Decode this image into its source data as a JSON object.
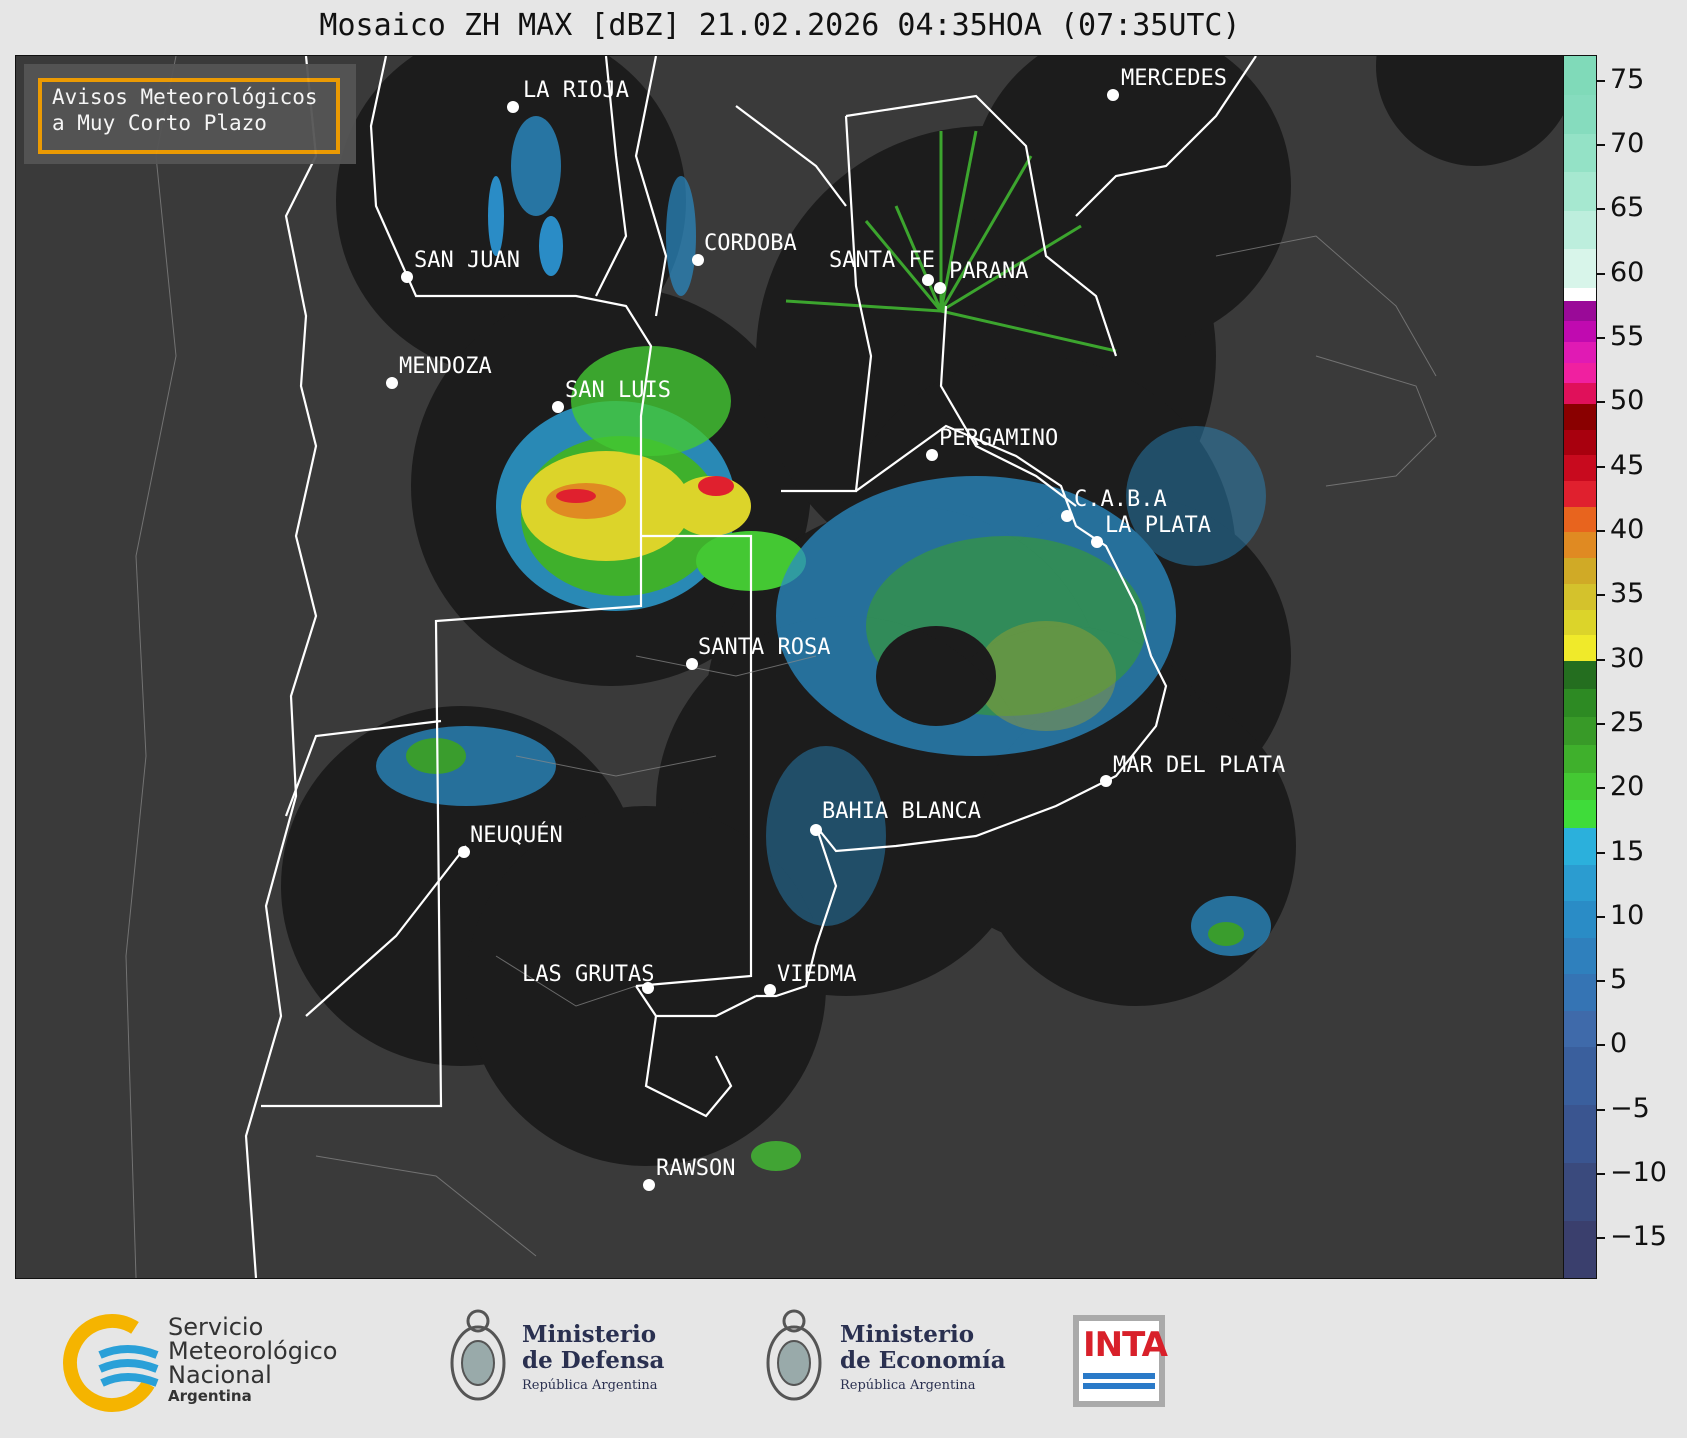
{
  "title": "Mosaico ZH MAX [dBZ] 21.02.2026 04:35HOA (07:35UTC)",
  "notice": {
    "line1": "Avisos Meteorológicos",
    "line2": "a Muy Corto Plazo",
    "border_color": "#f5a000"
  },
  "cities": [
    "LA RIOJA",
    "SAN JUAN",
    "CORDOBA",
    "SANTA FE",
    "PARANA",
    "MERCEDES",
    "MENDOZA",
    "SAN LUIS",
    "PERGAMINO",
    "C.A.B.A",
    "LA PLATA",
    "SANTA ROSA",
    "MAR DEL PLATA",
    "BAHIA BLANCA",
    "NEUQUÉN",
    "LAS GRUTAS",
    "VIEDMA",
    "RAWSON"
  ],
  "colorbar": {
    "unit": "dBZ",
    "ticks": [
      "75",
      "70",
      "65",
      "60",
      "55",
      "50",
      "45",
      "40",
      "35",
      "30",
      "25",
      "20",
      "15",
      "10",
      "5",
      "0",
      "−5",
      "−10",
      "−15"
    ],
    "tick_values": [
      75,
      70,
      65,
      60,
      55,
      50,
      45,
      40,
      35,
      30,
      25,
      20,
      15,
      10,
      5,
      0,
      -5,
      -10,
      -15
    ],
    "range": [
      -18,
      77
    ],
    "bands": [
      {
        "from": -18,
        "to": 0,
        "colors": [
          "#3a3f6d",
          "#3a4a7d",
          "#3a5590",
          "#3a5f9d"
        ]
      },
      {
        "from": 0,
        "to": 17,
        "colors": [
          "#3f6aaa",
          "#3574b4",
          "#2f80bd",
          "#2a8cc6",
          "#2b9cd0",
          "#2bb0dc"
        ]
      },
      {
        "from": 17,
        "to": 30,
        "colors": [
          "#3fdc3a",
          "#44c833",
          "#3fb02c",
          "#389a28",
          "#2d8a23",
          "#246e1f"
        ]
      },
      {
        "from": 30,
        "to": 40,
        "colors": [
          "#f0ea2a",
          "#dcd42a",
          "#d4c22c",
          "#d0aa26",
          "#e08a22"
        ]
      },
      {
        "from": 40,
        "to": 50,
        "colors": [
          "#e8641e",
          "#e0202e",
          "#c80a1e",
          "#a8000e",
          "#8a0000"
        ]
      },
      {
        "from": 50,
        "to": 58,
        "colors": [
          "#e0105a",
          "#f020a0",
          "#e01ab4",
          "#c00ab0",
          "#9a0a98"
        ]
      },
      {
        "from": 58,
        "to": 59,
        "colors": [
          "#ffffff"
        ]
      },
      {
        "from": 59,
        "to": 77,
        "colors": [
          "#d8f5ea",
          "#bdeedd",
          "#a6e8d0",
          "#94e2c6",
          "#86dcbe",
          "#80dab9"
        ]
      }
    ]
  },
  "logos": {
    "smn": {
      "line1": "Servicio",
      "line2": "Meteorológico",
      "line3": "Nacional",
      "line4": "Argentina"
    },
    "defensa": {
      "line1": "Ministerio",
      "line2": "de Defensa",
      "line3": "República Argentina"
    },
    "economia": {
      "line1": "Ministerio",
      "line2": "de Economía",
      "line3": "República Argentina"
    },
    "inta": {
      "text": "INTA"
    }
  }
}
